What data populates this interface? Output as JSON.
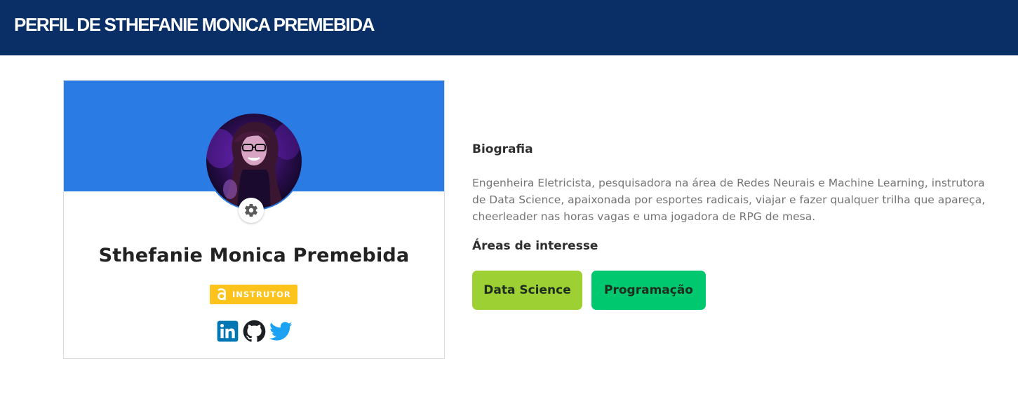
{
  "header": {
    "title": "PERFIL DE STHEFANIE MONICA PREMEBIDA"
  },
  "profile": {
    "name": "Sthefanie Monica Premebida",
    "badge": "INSTRUTOR",
    "avatar_alt": "avatar",
    "settings_icon": "gear-icon",
    "socials": [
      {
        "icon": "linkedin-icon"
      },
      {
        "icon": "github-icon"
      },
      {
        "icon": "twitter-icon"
      }
    ]
  },
  "bio": {
    "heading": "Biografia",
    "text": "Engenheira Eletricista, pesquisadora na área de Redes Neurais e Machine Learning, instrutora de Data Science, apaixonada por esportes radicais, viajar e fazer qualquer trilha que apareça, cheerleader nas horas vagas e uma jogadora de RPG de mesa."
  },
  "interests": {
    "heading": "Áreas de interesse",
    "items": [
      {
        "label": "Data Science",
        "color": "#9cd033"
      },
      {
        "label": "Programação",
        "color": "#00c86f"
      }
    ]
  },
  "colors": {
    "header_bg": "#0a2f66",
    "banner": "#2a7be4",
    "badge": "#fbc31b",
    "linkedin": "#0077b5",
    "twitter": "#1da1f2"
  }
}
